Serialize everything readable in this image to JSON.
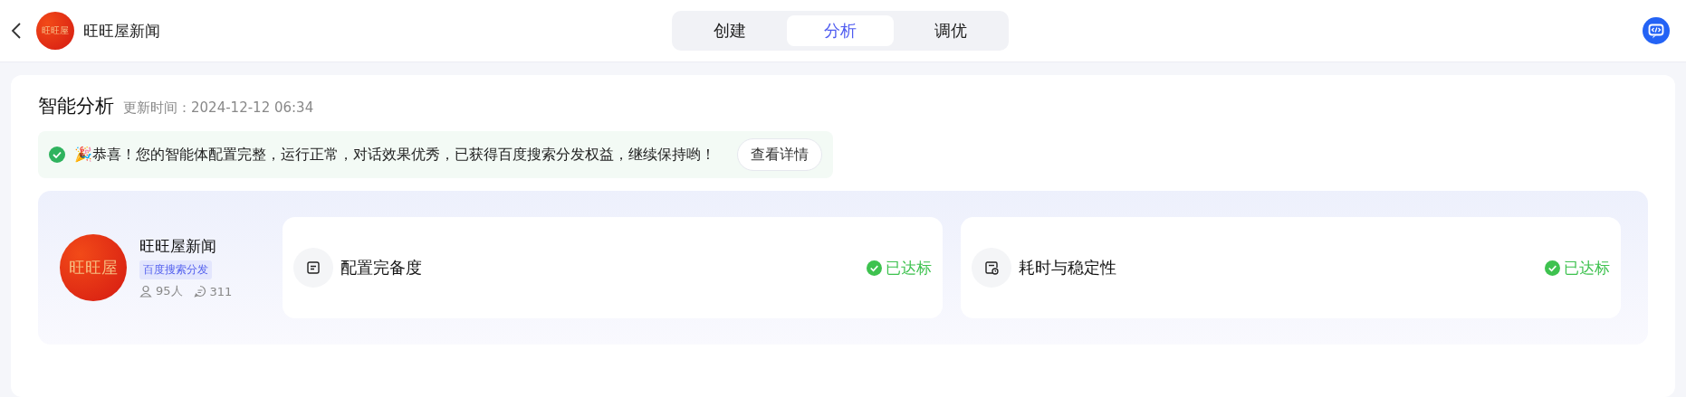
{
  "header": {
    "title": "旺旺屋新闻",
    "logo_text": "旺旺屋"
  },
  "tabs": [
    {
      "label": "创建",
      "selected": false
    },
    {
      "label": "分析",
      "selected": true
    },
    {
      "label": "调优",
      "selected": false
    }
  ],
  "analysis": {
    "title": "智能分析",
    "updated": "更新时间：2024-12-12 06:34",
    "banner": {
      "text": "🎉恭喜！您的智能体配置完整，运行正常，对话效果优秀，已获得百度搜索分发权益，继续保持哟！",
      "button": "查看详情"
    },
    "agent": {
      "name": "旺旺屋新闻",
      "logo_text": "旺旺屋",
      "tag": "百度搜索分发",
      "users": "95人",
      "messages": "311"
    },
    "metrics": [
      {
        "kind": "config",
        "label": "配置完备度",
        "status": "已达标",
        "passed": true
      },
      {
        "kind": "timing",
        "label": "耗时与稳定性",
        "status": "已达标",
        "passed": true
      }
    ]
  }
}
